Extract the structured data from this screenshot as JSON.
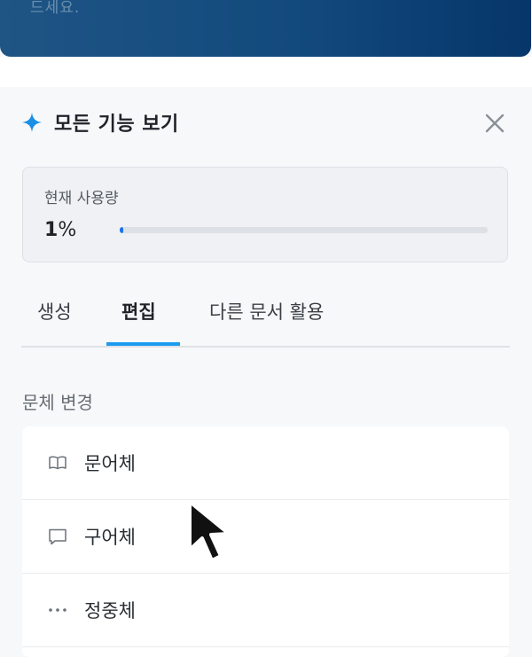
{
  "banner": {
    "fade_text": "드세요."
  },
  "panel": {
    "title": "모든 기능 보기",
    "title_icon": "sparkle-icon",
    "close_icon": "close-icon"
  },
  "usage": {
    "label": "현재 사용량",
    "value": "1",
    "unit": "%",
    "percent": 1,
    "accent_color": "#1a73e8"
  },
  "tabs": [
    {
      "label": "생성",
      "active": false
    },
    {
      "label": "편집",
      "active": true
    },
    {
      "label": "다른 문서 활용",
      "active": false
    }
  ],
  "section": {
    "title": "문체 변경"
  },
  "style_items": [
    {
      "label": "문어체",
      "icon": "book-icon"
    },
    {
      "label": "구어체",
      "icon": "speech-bubble-icon"
    },
    {
      "label": "정중체",
      "icon": "more-dots-icon"
    }
  ]
}
